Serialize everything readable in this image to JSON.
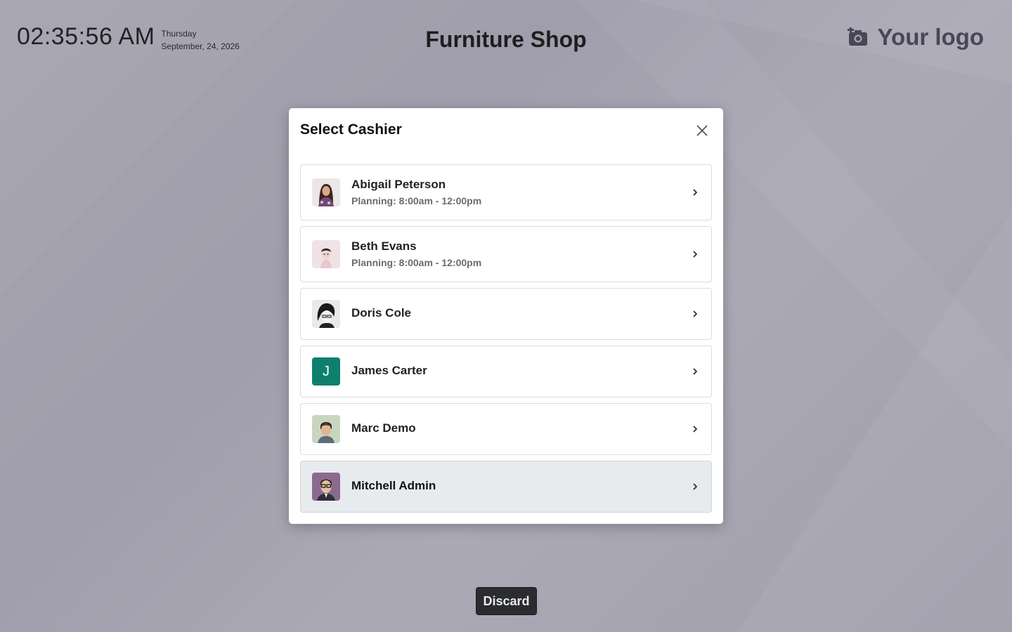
{
  "header": {
    "time": "02:35:56 AM",
    "weekday": "Thursday",
    "date": "September, 24, 2026",
    "shop_name": "Furniture Shop",
    "logo_text": "Your logo",
    "logo_icon": "add-photo-icon"
  },
  "modal": {
    "title": "Select Cashier",
    "close_icon": "close-icon",
    "cashiers": [
      {
        "name": "Abigail Peterson",
        "planning": "Planning: 8:00am - 12:00pm",
        "avatar": "photo"
      },
      {
        "name": "Beth Evans",
        "planning": "Planning: 8:00am - 12:00pm",
        "avatar": "photo"
      },
      {
        "name": "Doris Cole",
        "avatar": "photo"
      },
      {
        "name": "James Carter",
        "avatar_letter": "J",
        "avatar_color": "#0f7f6d"
      },
      {
        "name": "Marc Demo",
        "avatar": "photo"
      },
      {
        "name": "Mitchell Admin",
        "avatar": "photo",
        "highlighted": true
      }
    ]
  },
  "footer": {
    "discard_label": "Discard"
  },
  "colors": {
    "background": "#a7a5b1",
    "accent_avatar": "#0f7f6d",
    "discard_bg": "#2a2c2f"
  }
}
